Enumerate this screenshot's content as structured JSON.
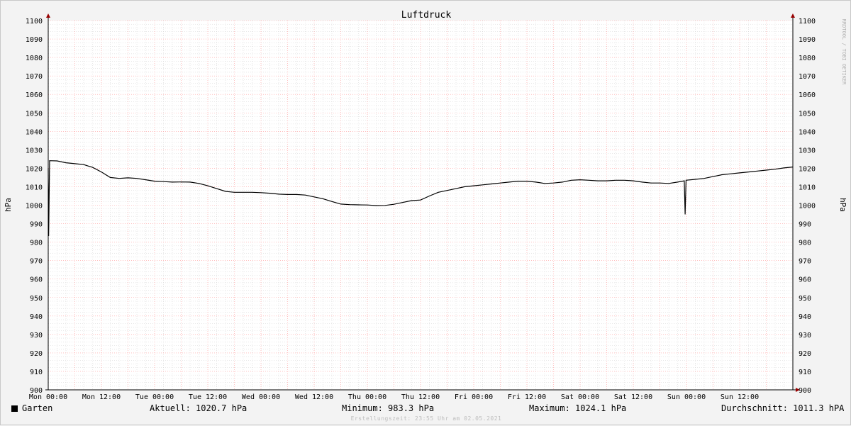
{
  "chart_data": {
    "type": "line",
    "title": "Luftdruck",
    "ylabel": "hPa",
    "ylabel_right": "hPa",
    "ylim": [
      900,
      1100
    ],
    "y_ticks": [
      900,
      910,
      920,
      930,
      940,
      950,
      960,
      970,
      980,
      990,
      1000,
      1010,
      1020,
      1030,
      1040,
      1050,
      1060,
      1070,
      1080,
      1090,
      1100
    ],
    "x_range_hours": [
      0,
      168
    ],
    "x_ticks": [
      {
        "h": 0,
        "label": "Mon 00:00"
      },
      {
        "h": 12,
        "label": "Mon 12:00"
      },
      {
        "h": 24,
        "label": "Tue 00:00"
      },
      {
        "h": 36,
        "label": "Tue 12:00"
      },
      {
        "h": 48,
        "label": "Wed 00:00"
      },
      {
        "h": 60,
        "label": "Wed 12:00"
      },
      {
        "h": 72,
        "label": "Thu 00:00"
      },
      {
        "h": 84,
        "label": "Thu 12:00"
      },
      {
        "h": 96,
        "label": "Fri 00:00"
      },
      {
        "h": 108,
        "label": "Fri 12:00"
      },
      {
        "h": 120,
        "label": "Sat 00:00"
      },
      {
        "h": 132,
        "label": "Sat 12:00"
      },
      {
        "h": 144,
        "label": "Sun 00:00"
      },
      {
        "h": 156,
        "label": "Sun 12:00"
      }
    ],
    "grid": true,
    "series": [
      {
        "name": "Garten",
        "color": "#000000",
        "points": [
          [
            0.0,
            1020
          ],
          [
            0.1,
            983.3
          ],
          [
            0.3,
            1024.1
          ],
          [
            2,
            1024
          ],
          [
            4,
            1023
          ],
          [
            6,
            1022.5
          ],
          [
            8,
            1022
          ],
          [
            10,
            1020.5
          ],
          [
            12,
            1018
          ],
          [
            14,
            1015
          ],
          [
            16,
            1014.5
          ],
          [
            18,
            1014.8
          ],
          [
            20,
            1014.5
          ],
          [
            22,
            1013.8
          ],
          [
            24,
            1013
          ],
          [
            26,
            1012.8
          ],
          [
            28,
            1012.5
          ],
          [
            30,
            1012.6
          ],
          [
            32,
            1012.5
          ],
          [
            34,
            1011.8
          ],
          [
            36,
            1010.5
          ],
          [
            38,
            1009
          ],
          [
            40,
            1007.5
          ],
          [
            42,
            1007
          ],
          [
            44,
            1007
          ],
          [
            46,
            1007
          ],
          [
            48,
            1006.8
          ],
          [
            50,
            1006.5
          ],
          [
            52,
            1006
          ],
          [
            54,
            1005.8
          ],
          [
            56,
            1005.8
          ],
          [
            58,
            1005.5
          ],
          [
            60,
            1004.5
          ],
          [
            62,
            1003.5
          ],
          [
            64,
            1002
          ],
          [
            66,
            1000.6
          ],
          [
            68,
            1000.3
          ],
          [
            70,
            1000.2
          ],
          [
            72,
            1000.1
          ],
          [
            74,
            999.8
          ],
          [
            76,
            999.9
          ],
          [
            78,
            1000.5
          ],
          [
            80,
            1001.5
          ],
          [
            82,
            1002.5
          ],
          [
            84,
            1002.8
          ],
          [
            86,
            1005
          ],
          [
            88,
            1007
          ],
          [
            90,
            1008
          ],
          [
            92,
            1009
          ],
          [
            94,
            1010
          ],
          [
            96,
            1010.5
          ],
          [
            98,
            1011
          ],
          [
            100,
            1011.5
          ],
          [
            102,
            1012
          ],
          [
            104,
            1012.5
          ],
          [
            106,
            1013
          ],
          [
            108,
            1013
          ],
          [
            110,
            1012.5
          ],
          [
            112,
            1011.8
          ],
          [
            114,
            1012
          ],
          [
            116,
            1012.5
          ],
          [
            118,
            1013.5
          ],
          [
            120,
            1013.8
          ],
          [
            122,
            1013.5
          ],
          [
            124,
            1013.2
          ],
          [
            126,
            1013.2
          ],
          [
            128,
            1013.5
          ],
          [
            130,
            1013.5
          ],
          [
            132,
            1013.2
          ],
          [
            134,
            1012.5
          ],
          [
            136,
            1012
          ],
          [
            138,
            1012
          ],
          [
            140,
            1011.8
          ],
          [
            142,
            1012.5
          ],
          [
            143.5,
            1013.2
          ],
          [
            143.7,
            995
          ],
          [
            143.9,
            1013.5
          ],
          [
            146,
            1014
          ],
          [
            148,
            1014.5
          ],
          [
            150,
            1015.5
          ],
          [
            152,
            1016.5
          ],
          [
            154,
            1017
          ],
          [
            156,
            1017.5
          ],
          [
            158,
            1018
          ],
          [
            160,
            1018.5
          ],
          [
            162,
            1019
          ],
          [
            164,
            1019.5
          ],
          [
            166,
            1020.2
          ],
          [
            168,
            1020.7
          ]
        ]
      }
    ]
  },
  "legend": {
    "series_name": "Garten",
    "current": "Aktuell: 1020.7 hPa",
    "minimum": "Minimum: 983.3 hPa",
    "maximum": "Maximum: 1024.1 hPa",
    "average": "Durchschnitt: 1011.3 hPA"
  },
  "side_text": "RRDTOOL / TOBI OETIKER",
  "footer_text": "Erstellungszeit: 23:55 Uhr am 02.05.2021",
  "colors": {
    "background": "#f3f3f3",
    "plot_bg": "#ffffff",
    "grid_major": "#ff9999",
    "grid_minor": "#d0d0d0",
    "axis": "#000000",
    "arrow": "#990000",
    "line": "#000000"
  }
}
